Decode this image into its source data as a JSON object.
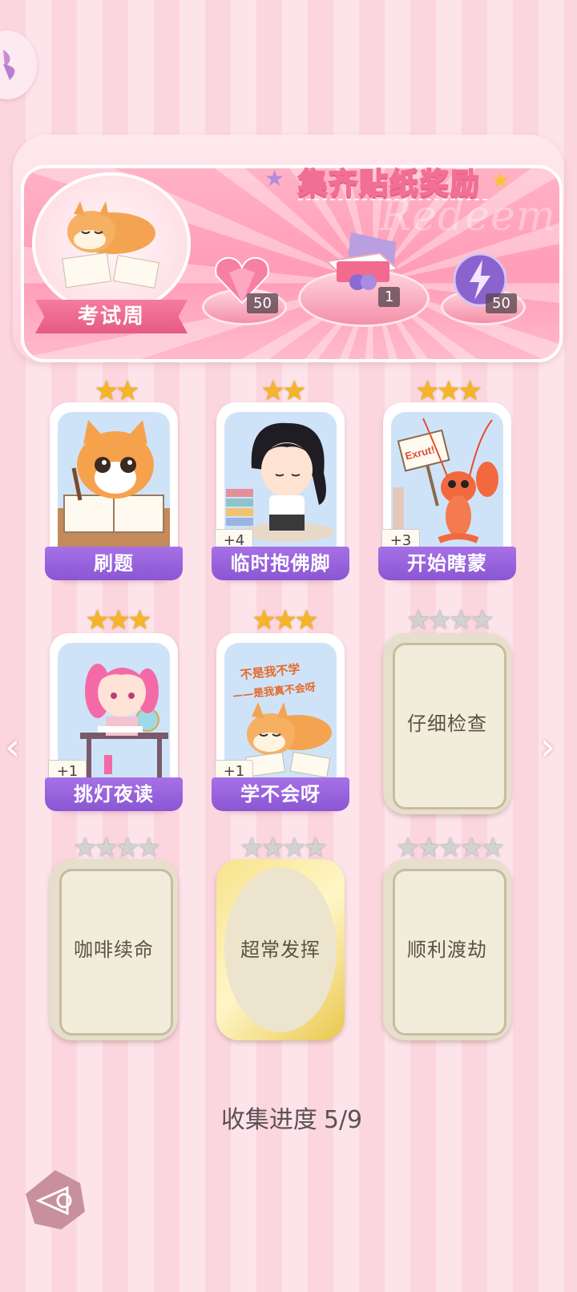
{
  "banner": {
    "title": "集齐贴纸奖励",
    "watermark": "Redeem",
    "album_name": "考试周",
    "rewards": [
      {
        "icon": "pink-heart-gem-icon",
        "count": "50"
      },
      {
        "icon": "gift-box-icon",
        "count": "1"
      },
      {
        "icon": "purple-lightning-orb-icon",
        "count": "50"
      }
    ]
  },
  "cards": [
    {
      "name": "刷题",
      "stars": 2,
      "collected": true,
      "plus": "",
      "art": "cat-studying"
    },
    {
      "name": "临时抱佛脚",
      "stars": 2,
      "collected": true,
      "plus": "+4",
      "art": "girl-praying"
    },
    {
      "name": "开始瞎蒙",
      "stars": 3,
      "collected": true,
      "plus": "+3",
      "art": "crayfish-sign",
      "sign_text": "Exrut!"
    },
    {
      "name": "挑灯夜读",
      "stars": 3,
      "collected": true,
      "plus": "+1",
      "art": "pink-hair-girl-desk"
    },
    {
      "name": "学不会呀",
      "stars": 3,
      "collected": true,
      "plus": "+1",
      "art": "shiba-lying",
      "art_text": [
        "不是我不学",
        "——是我真不会呀"
      ]
    },
    {
      "name": "仔细检查",
      "stars": 4,
      "collected": false,
      "plus": ""
    },
    {
      "name": "咖啡续命",
      "stars": 4,
      "collected": false,
      "plus": ""
    },
    {
      "name": "超常发挥",
      "stars": 4,
      "collected": false,
      "plus": "",
      "gold_frame": true
    },
    {
      "name": "顺利渡劫",
      "stars": 5,
      "collected": false,
      "plus": ""
    }
  ],
  "progress": {
    "label": "收集进度",
    "value": "5/9"
  },
  "colors": {
    "accent_purple": "#8a56d3",
    "banner_pink": "#ff9cb6",
    "star_gold": "#f5b524",
    "star_grey": "#d2d2d2"
  }
}
